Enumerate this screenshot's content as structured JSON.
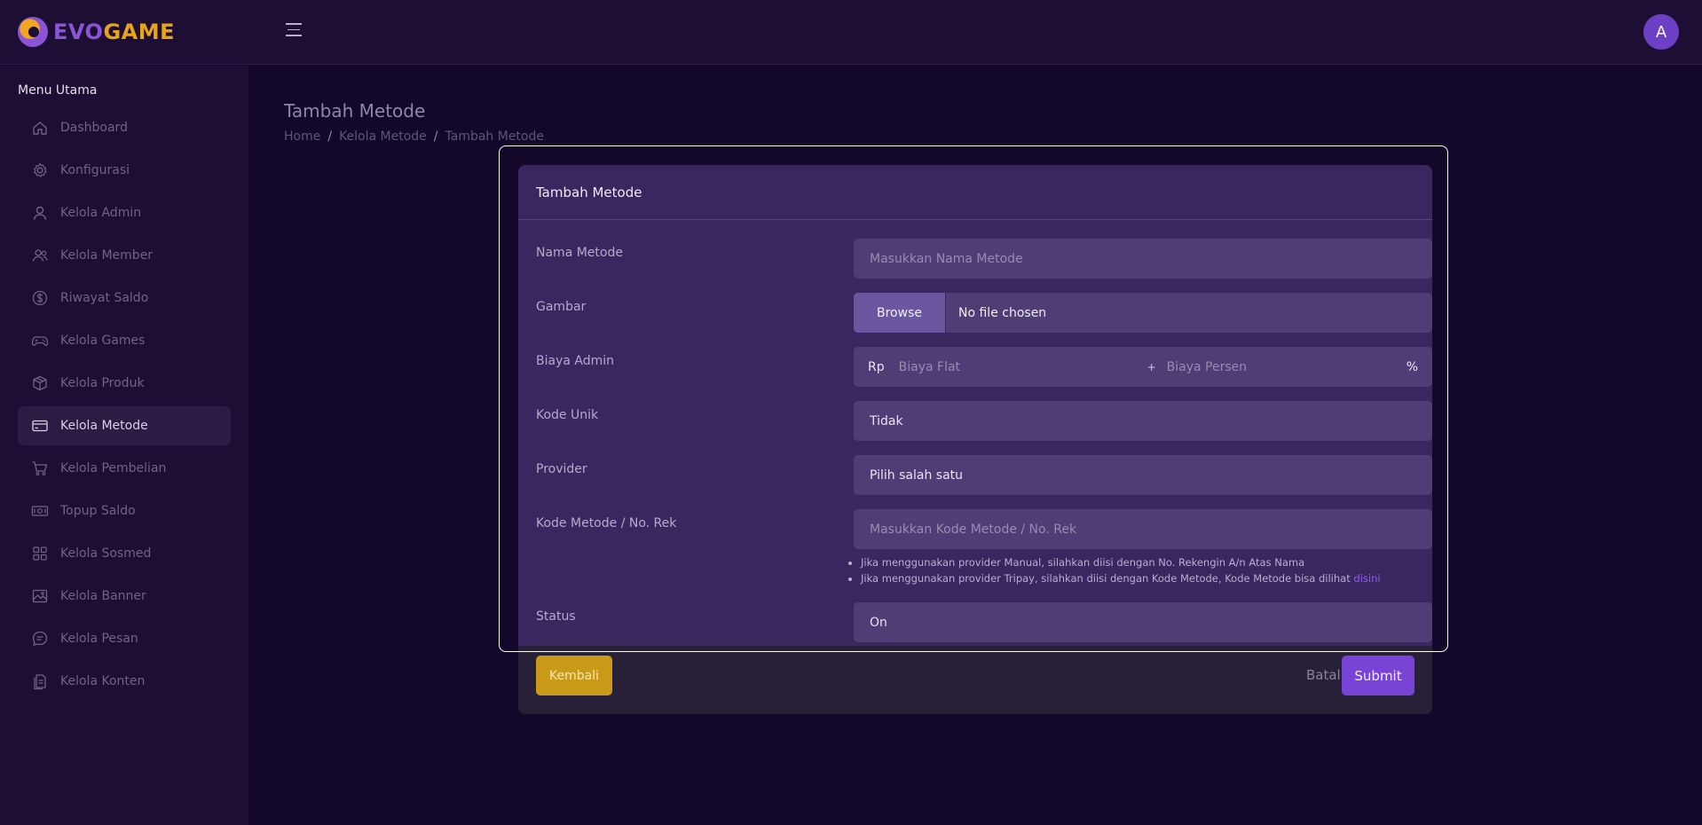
{
  "brand": {
    "part1": "EVO",
    "part2": "GAME"
  },
  "user": {
    "avatar_initial": "A"
  },
  "sidebar": {
    "title": "Menu Utama",
    "items": [
      {
        "label": "Dashboard",
        "icon": "home-icon"
      },
      {
        "label": "Konfigurasi",
        "icon": "gear-icon"
      },
      {
        "label": "Kelola Admin",
        "icon": "user-icon"
      },
      {
        "label": "Kelola Member",
        "icon": "users-icon"
      },
      {
        "label": "Riwayat Saldo",
        "icon": "dollar-icon"
      },
      {
        "label": "Kelola Games",
        "icon": "gamepad-icon"
      },
      {
        "label": "Kelola Produk",
        "icon": "box-icon"
      },
      {
        "label": "Kelola Metode",
        "icon": "card-icon",
        "active": true
      },
      {
        "label": "Kelola Pembelian",
        "icon": "cart-icon"
      },
      {
        "label": "Topup Saldo",
        "icon": "cash-icon"
      },
      {
        "label": "Kelola Sosmed",
        "icon": "grid-icon"
      },
      {
        "label": "Kelola Banner",
        "icon": "image-icon"
      },
      {
        "label": "Kelola Pesan",
        "icon": "chat-icon"
      },
      {
        "label": "Kelola Konten",
        "icon": "document-icon"
      }
    ]
  },
  "page": {
    "title": "Tambah Metode",
    "breadcrumb": [
      "Home",
      "Kelola Metode",
      "Tambah Metode"
    ]
  },
  "form": {
    "card_title": "Tambah Metode",
    "nama_metode": {
      "label": "Nama Metode",
      "placeholder": "Masukkan Nama Metode"
    },
    "gambar": {
      "label": "Gambar",
      "browse": "Browse",
      "file_status": "No file chosen"
    },
    "biaya_admin": {
      "label": "Biaya Admin",
      "prefix": "Rp",
      "flat_placeholder": "Biaya Flat",
      "plus": "+",
      "persen_placeholder": "Biaya Persen",
      "suffix": "%"
    },
    "kode_unik": {
      "label": "Kode Unik",
      "value": "Tidak"
    },
    "provider": {
      "label": "Provider",
      "value": "Pilih salah satu"
    },
    "kode_metode": {
      "label": "Kode Metode / No. Rek",
      "placeholder": "Masukkan Kode Metode / No. Rek",
      "hint1": "Jika menggunakan provider Manual, silahkan diisi dengan No. Rekengin A/n Atas Nama",
      "hint2": "Jika menggunakan provider Tripay, silahkan diisi dengan Kode Metode, Kode Metode bisa dilihat",
      "hint2_link": "disini"
    },
    "status": {
      "label": "Status",
      "value": "On"
    },
    "buttons": {
      "back": "Kembali",
      "cancel": "Batal",
      "submit": "Submit"
    }
  },
  "colors": {
    "background": "#14082a",
    "sidebar": "#1c0f33",
    "card": "#3a2760",
    "accent_purple": "#7844d6",
    "accent_yellow": "#c99a17",
    "brand_purple": "#8a54d6",
    "brand_orange": "#e7a41a"
  }
}
